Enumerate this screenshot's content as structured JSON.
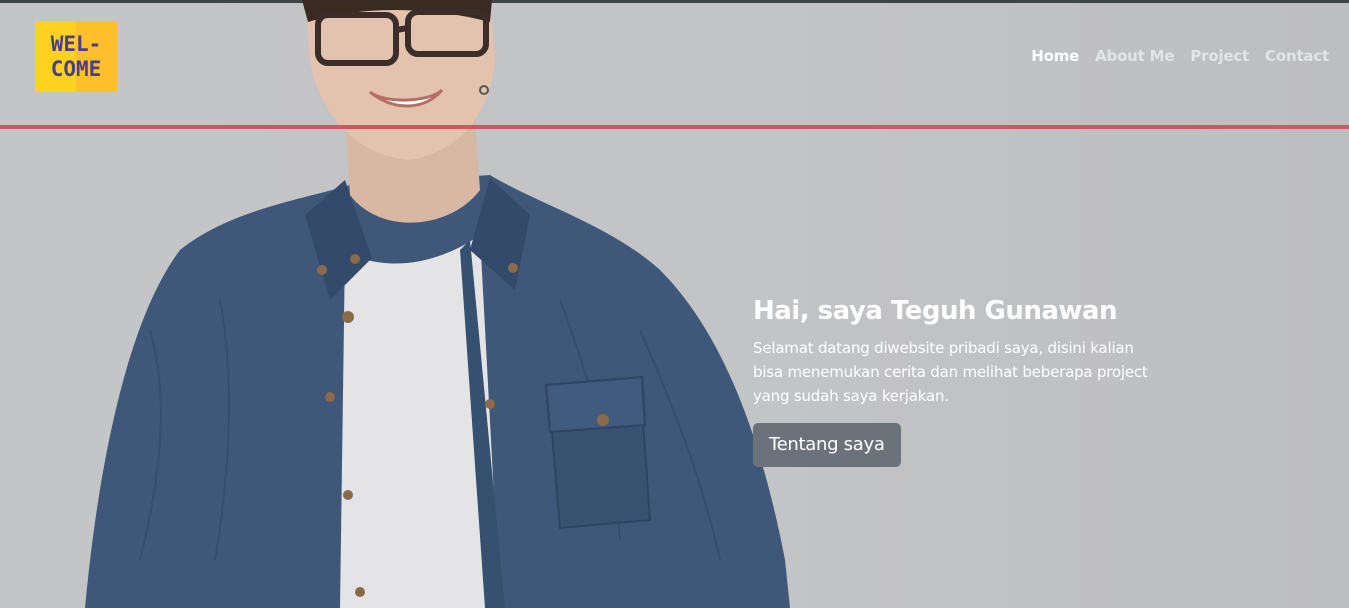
{
  "brand": {
    "logo_line1": "WEL-",
    "logo_line2": "COME",
    "logo_colors": [
      "#ffd21f",
      "#ffbf2a"
    ],
    "logo_text_color": "#4a3f8c"
  },
  "nav": {
    "items": [
      {
        "label": "Home",
        "active": true
      },
      {
        "label": "About Me",
        "active": false
      },
      {
        "label": "Project",
        "active": false
      },
      {
        "label": "Contact",
        "active": false
      }
    ]
  },
  "hero": {
    "title": "Hai, saya Teguh Gunawan",
    "description": "Selamat datang diwebsite pribadi saya, disini kalian bisa menemukan cerita dan melihat beberapa project yang sudah saya kerjakan.",
    "button_label": "Tentang saya",
    "accent_line_color": "#d6545f",
    "button_color": "#6c727b"
  }
}
